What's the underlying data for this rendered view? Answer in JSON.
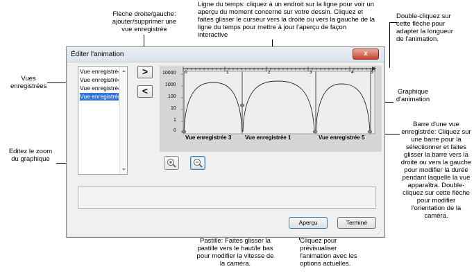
{
  "callouts": {
    "fleche": "Flèche droite/gauche: ajouter/supprimer une vue enregistrée",
    "ligne_temps": "Ligne du temps: cliquez à un endroit sur la ligne pour voir un aperçu du moment concerné sur votre dessin. Cliquez et faites glisser le curseur vers la droite ou vers la gauche de la ligne du temps pour mettre à jour l'aperçu de façon interactive",
    "double_clic_longueur": "Double-cliquez sur cette flèche pour adapter la longueur de l'animation.",
    "vues_enregistrees": "Vues enregistrées",
    "graphique": "Graphique d'animation",
    "barre_vue": "Barre d'une vue enregistrée: Cliquez sur une barre pour la sélectionner et faites glisser la barre vers la droite ou vers la gauche pour modifier la durée pendant laquelle la vue apparaîtra. Double-cliquez sur cette flèche pour modifier l'orientation de la caméra.",
    "zoom": "Editez le zoom du graphique",
    "pastille": "Pastille: Faites glisser la pastille vers le haut/le bas pour modifier la vitesse de la caméra.",
    "apercu": "Cliquez pour prévisualiser l'animation avec les options actuelles."
  },
  "dialog": {
    "title": "Éditer l'animation",
    "close": "x",
    "list_items": [
      "Vue enregistrée",
      "Vue enregistrée",
      "Vue enregistrée",
      "Vue enregistrée"
    ],
    "selected_index": 3,
    "add_arrow": ">",
    "remove_arrow": "<",
    "preview_label": "Aperçu",
    "done_label": "Terminé"
  },
  "graph": {
    "y_ticks": [
      "10000",
      "1000",
      "100",
      "10",
      "1",
      "0"
    ],
    "timeline_ticks": [
      "0",
      "1",
      "2",
      "3",
      "4",
      "5"
    ],
    "segment_labels": [
      "Vue enregistrée 3",
      "Vue enregistrée 1",
      "Vue enregistrée 5"
    ]
  },
  "colors": {
    "selection": "#3173d6",
    "close_button": "#c9452f",
    "graph_background": "#d6d6d6"
  }
}
